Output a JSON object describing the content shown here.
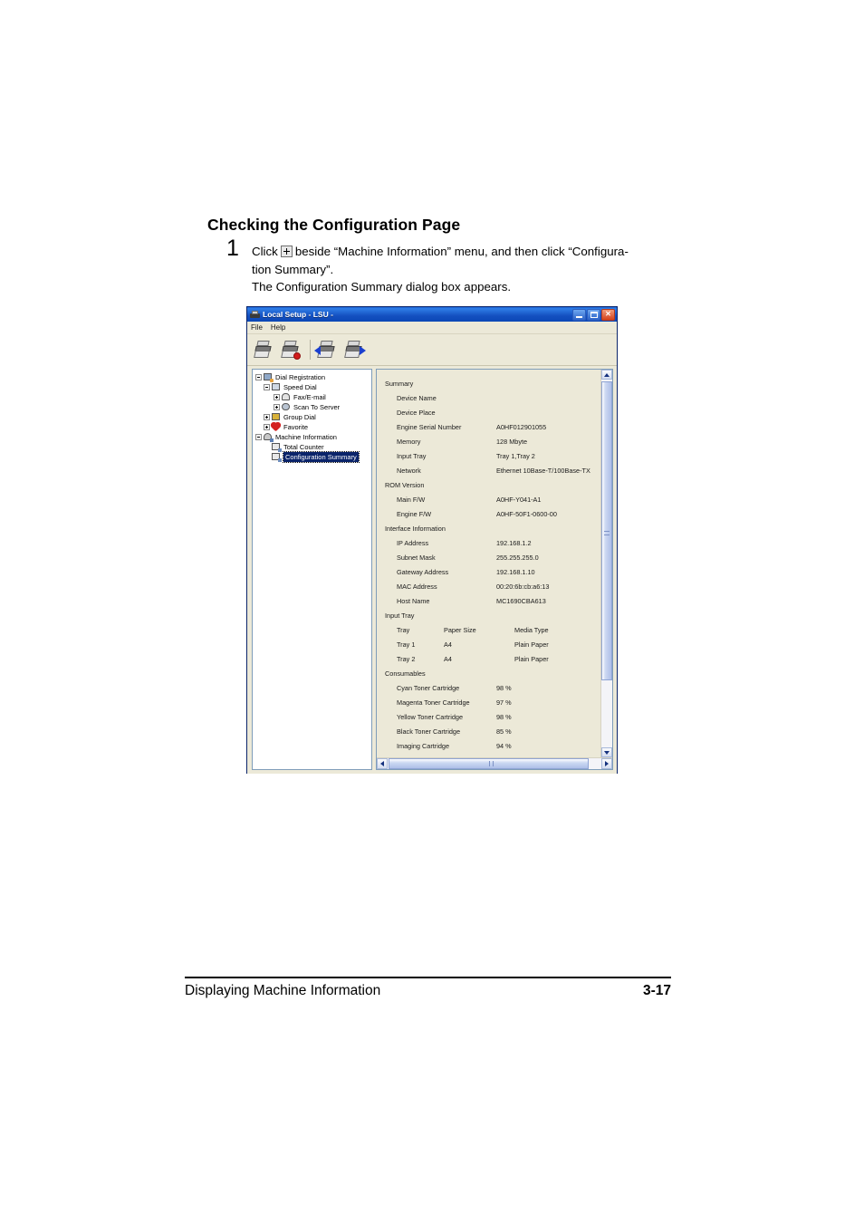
{
  "page": {
    "heading": "Checking the Configuration Page",
    "step_number": "1",
    "step_line1_a": "Click",
    "step_line1_b": "beside “Machine Information” menu, and then click “Configura-",
    "step_line2": "tion Summary”.",
    "step_line3": "The Configuration Summary dialog box appears."
  },
  "footer": {
    "left": "Displaying Machine Information",
    "right": "3-17"
  },
  "window": {
    "title": "Local Setup - LSU -",
    "menus": [
      "File",
      "Help"
    ],
    "toolbar_icons": [
      "printer-icon",
      "printer-disabled-icon",
      "printer-receive-icon",
      "printer-send-icon"
    ],
    "buttons": {
      "minimize": "minimize-button",
      "maximize": "maximize-button",
      "close": "close-button"
    }
  },
  "tree": {
    "nodes": [
      {
        "label": "Dial Registration",
        "depth": 0,
        "toggle": "minus",
        "icon": "dialreg",
        "selected": false
      },
      {
        "label": "Speed Dial",
        "depth": 1,
        "toggle": "minus",
        "icon": "speed",
        "selected": false
      },
      {
        "label": "Fax/E-mail",
        "depth": 2,
        "toggle": "plus",
        "icon": "fax",
        "selected": false
      },
      {
        "label": "Scan To Server",
        "depth": 2,
        "toggle": "plus",
        "icon": "scan",
        "selected": false
      },
      {
        "label": "Group Dial",
        "depth": 1,
        "toggle": "plus",
        "icon": "group",
        "selected": false
      },
      {
        "label": "Favorite",
        "depth": 1,
        "toggle": "plus",
        "icon": "fav",
        "selected": false
      },
      {
        "label": "Machine Information",
        "depth": 0,
        "toggle": "minus",
        "icon": "machine",
        "selected": false
      },
      {
        "label": "Total Counter",
        "depth": 1,
        "toggle": "none",
        "icon": "doc",
        "selected": false
      },
      {
        "label": "Configuration Summary",
        "depth": 1,
        "toggle": "none",
        "icon": "doc",
        "selected": true
      }
    ]
  },
  "summary": {
    "sections": [
      {
        "title": "Summary",
        "rows": [
          {
            "label": "Device Name",
            "value": ""
          },
          {
            "label": "Device Place",
            "value": ""
          },
          {
            "label": "Engine Serial Number",
            "value": "A0HF012901055"
          },
          {
            "label": "Memory",
            "value": "128 Mbyte"
          },
          {
            "label": "Input Tray",
            "value": "Tray 1,Tray 2"
          },
          {
            "label": "Network",
            "value": "Ethernet 10Base-T/100Base-TX"
          }
        ]
      },
      {
        "title": "ROM Version",
        "rows": [
          {
            "label": "Main F/W",
            "value": "A0HF-Y041-A1"
          },
          {
            "label": "Engine F/W",
            "value": "A0HF-50F1-0600-00"
          }
        ]
      },
      {
        "title": "Interface Information",
        "rows": [
          {
            "label": "IP Address",
            "value": "192.168.1.2"
          },
          {
            "label": "Subnet Mask",
            "value": "255.255.255.0"
          },
          {
            "label": "Gateway Address",
            "value": "192.168.1.10"
          },
          {
            "label": "MAC Address",
            "value": "00:20:6b:cb:a6:13"
          },
          {
            "label": "Host Name",
            "value": "MC1690CBA613"
          }
        ]
      }
    ],
    "input_tray": {
      "title": "Input Tray",
      "header": {
        "c1": "Tray",
        "c2": "Paper Size",
        "c3": "Media Type"
      },
      "rows": [
        {
          "c1": "Tray 1",
          "c2": "A4",
          "c3": "Plain Paper"
        },
        {
          "c1": "Tray 2",
          "c2": "A4",
          "c3": "Plain Paper"
        }
      ]
    },
    "consumables": {
      "title": "Consumables",
      "rows": [
        {
          "label": "Cyan Toner Cartridge",
          "value": "98 %"
        },
        {
          "label": "Magenta Toner Cartridge",
          "value": "97 %"
        },
        {
          "label": "Yellow Toner Cartridge",
          "value": "98 %"
        },
        {
          "label": "Black Toner Cartridge",
          "value": "85 %"
        },
        {
          "label": "Imaging Cartridge",
          "value": "94 %"
        }
      ]
    }
  }
}
